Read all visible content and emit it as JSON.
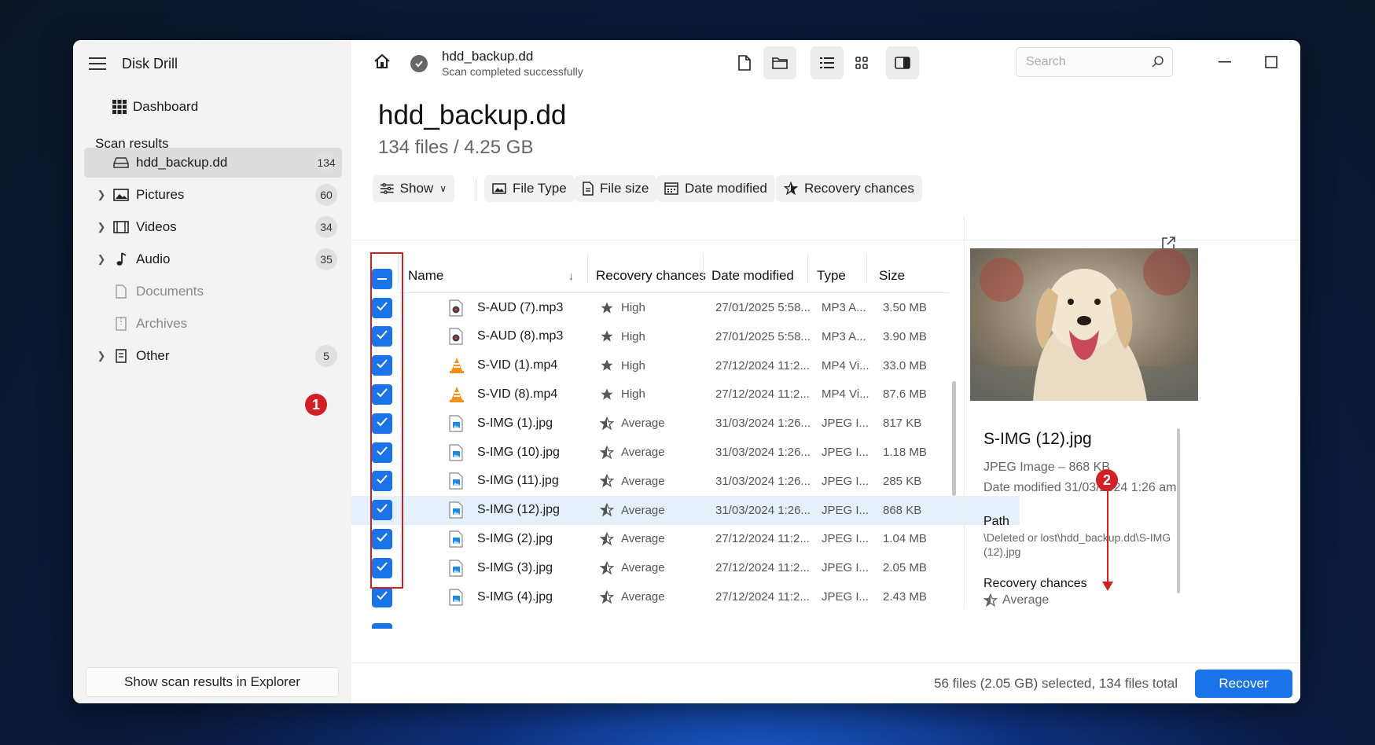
{
  "app": {
    "title": "Disk Drill"
  },
  "sidebar": {
    "dashboard": "Dashboard",
    "section_title": "Scan results",
    "items": [
      {
        "label": "hdd_backup.dd",
        "count": "134"
      },
      {
        "label": "Pictures",
        "count": "60"
      },
      {
        "label": "Videos",
        "count": "34"
      },
      {
        "label": "Audio",
        "count": "35"
      },
      {
        "label": "Documents",
        "count": ""
      },
      {
        "label": "Archives",
        "count": ""
      },
      {
        "label": "Other",
        "count": "5"
      }
    ],
    "explorer_button": "Show scan results in Explorer"
  },
  "topbar": {
    "name": "hdd_backup.dd",
    "status": "Scan completed successfully",
    "search_placeholder": "Search"
  },
  "header": {
    "title": "hdd_backup.dd",
    "subtitle": "134 files / 4.25 GB"
  },
  "filters": {
    "show": "Show",
    "file_type": "File Type",
    "file_size": "File size",
    "date_modified": "Date modified",
    "recovery_chances": "Recovery chances"
  },
  "table": {
    "columns": {
      "name": "Name",
      "recovery": "Recovery chances",
      "date": "Date modified",
      "type": "Type",
      "size": "Size"
    },
    "rows": [
      {
        "name": "S-AUD (7).mp3",
        "recovery": "High",
        "date": "27/01/2025 5:58...",
        "type": "MP3 A...",
        "size": "3.50 MB",
        "kind": "audio"
      },
      {
        "name": "S-AUD (8).mp3",
        "recovery": "High",
        "date": "27/01/2025 5:58...",
        "type": "MP3 A...",
        "size": "3.90 MB",
        "kind": "audio"
      },
      {
        "name": "S-VID (1).mp4",
        "recovery": "High",
        "date": "27/12/2024 11:2...",
        "type": "MP4 Vi...",
        "size": "33.0 MB",
        "kind": "video"
      },
      {
        "name": "S-VID (8).mp4",
        "recovery": "High",
        "date": "27/12/2024 11:2...",
        "type": "MP4 Vi...",
        "size": "87.6 MB",
        "kind": "video"
      },
      {
        "name": "S-IMG (1).jpg",
        "recovery": "Average",
        "date": "31/03/2024 1:26...",
        "type": "JPEG I...",
        "size": "817 KB",
        "kind": "image"
      },
      {
        "name": "S-IMG (10).jpg",
        "recovery": "Average",
        "date": "31/03/2024 1:26...",
        "type": "JPEG I...",
        "size": "1.18 MB",
        "kind": "image"
      },
      {
        "name": "S-IMG (11).jpg",
        "recovery": "Average",
        "date": "31/03/2024 1:26...",
        "type": "JPEG I...",
        "size": "285 KB",
        "kind": "image"
      },
      {
        "name": "S-IMG (12).jpg",
        "recovery": "Average",
        "date": "31/03/2024 1:26...",
        "type": "JPEG I...",
        "size": "868 KB",
        "kind": "image"
      },
      {
        "name": "S-IMG (2).jpg",
        "recovery": "Average",
        "date": "27/12/2024 11:2...",
        "type": "JPEG I...",
        "size": "1.04 MB",
        "kind": "image"
      },
      {
        "name": "S-IMG (3).jpg",
        "recovery": "Average",
        "date": "27/12/2024 11:2...",
        "type": "JPEG I...",
        "size": "2.05 MB",
        "kind": "image"
      },
      {
        "name": "S-IMG (4).jpg",
        "recovery": "Average",
        "date": "27/12/2024 11:2...",
        "type": "JPEG I...",
        "size": "2.43 MB",
        "kind": "image"
      }
    ]
  },
  "preview": {
    "name": "S-IMG (12).jpg",
    "meta": "JPEG Image – 868 KB",
    "date": "Date modified 31/03/2024 1:26 am",
    "path_label": "Path",
    "path": "\\Deleted or lost\\hdd_backup.dd\\S-IMG (12).jpg",
    "recovery_label": "Recovery chances",
    "recovery_value": "Average"
  },
  "footer": {
    "status": "56 files (2.05 GB) selected, 134 files total",
    "recover": "Recover"
  },
  "annotations": {
    "marker1": "1",
    "marker2": "2"
  },
  "colors": {
    "accent": "#1a73e8",
    "annotation_red": "#d32027"
  }
}
